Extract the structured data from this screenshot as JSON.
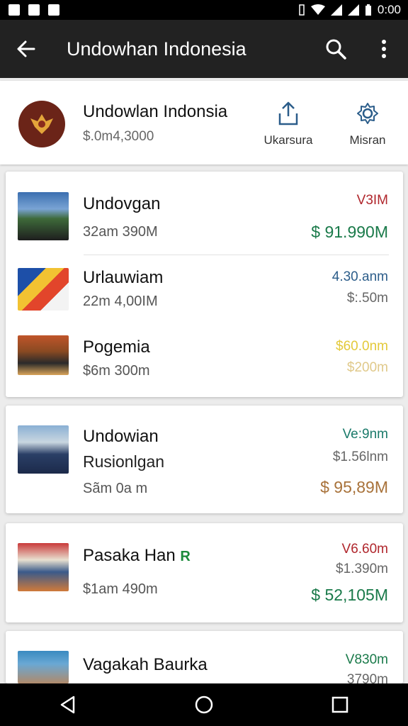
{
  "status_bar": {
    "time": "0:00"
  },
  "app_bar": {
    "title": "Undowhan Indonesia"
  },
  "header": {
    "name": "Undowlan Indonsia",
    "subtitle": "$.0m4,3000",
    "buttons": [
      {
        "label": "Ukarsura",
        "icon": "share-icon"
      },
      {
        "label": "Misran",
        "icon": "settings-icon"
      }
    ]
  },
  "cards": [
    {
      "rows": [
        {
          "name": "Undovgan",
          "sub": "32am 390M",
          "right_top": "V3IM",
          "right_top_color": "#b0262c",
          "right_bottom": "$ 91.990M",
          "right_bottom_color": "#1a7a4a"
        },
        {
          "name": "Urlauwiam",
          "sub": "22m 4,00IM",
          "right_top": "4.30.anm",
          "right_top_color": "#2c5d8a",
          "right_bottom": "$:.50m",
          "right_bottom_color": "#666666"
        },
        {
          "name": "Pogemia",
          "sub": "$6m 300m",
          "right_top": "$60.0nm",
          "right_top_color": "#e3c93a",
          "right_bottom": "$200m",
          "right_bottom_color": "#e0c98a"
        }
      ]
    },
    {
      "rows": [
        {
          "name": "Undowian",
          "name2": "Rusionlgan",
          "sub": "Sãm 0a m",
          "right_top": "Ve:9nm",
          "right_top_color": "#1a7a6a",
          "right_mid": "$1.56lnm",
          "right_bottom": "$ 95,89M",
          "right_bottom_color": "#a8723a"
        }
      ]
    },
    {
      "rows": [
        {
          "name": "Pasaka Han",
          "badge": "R",
          "sub": "$1am 490m",
          "right_top": "V6.60m",
          "right_top_color": "#b0262c",
          "right_mid": "$1.390m",
          "right_bottom": "$ 52,105M",
          "right_bottom_color": "#1a7a4a"
        }
      ]
    },
    {
      "rows": [
        {
          "name": "Vagakah Baurka",
          "right_top": "V830m",
          "right_top_color": "#1a7a4a",
          "right_mid": "3790m"
        }
      ]
    }
  ]
}
